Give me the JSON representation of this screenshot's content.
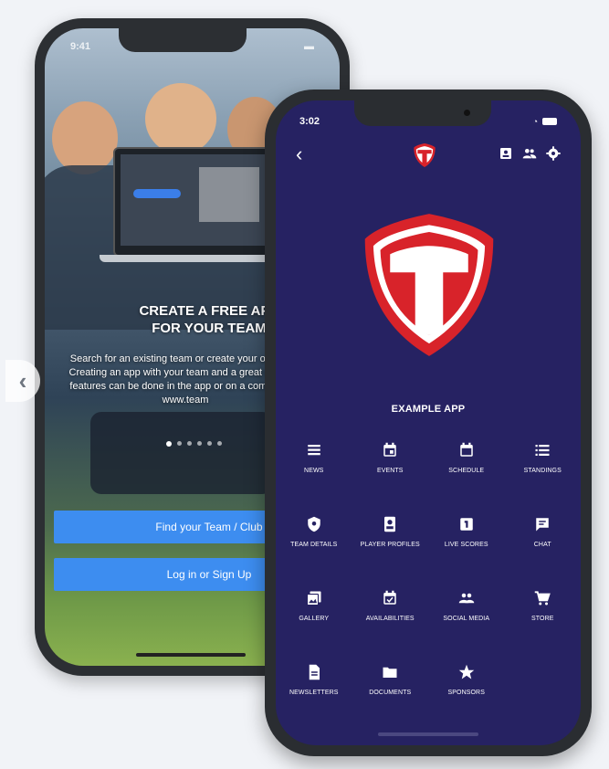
{
  "colors": {
    "front_bg": "#262262",
    "accent_red": "#d8232a",
    "button_blue": "#3d8df0"
  },
  "back_phone": {
    "status_time": "9:41",
    "hero_title_line1": "CREATE A FREE APP",
    "hero_title_line2": "FOR YOUR TEAM",
    "hero_body": "Search for an existing team or create your own app. Creating an app with your team and a great range of features can be done in the app or on a computer at www.team",
    "carousel_dots": 6,
    "find_button": "Find your Team / Club",
    "login_button": "Log in or Sign Up",
    "carousel_prev": "‹"
  },
  "front_phone": {
    "status_time": "3:02",
    "back_icon": "‹",
    "app_name": "EXAMPLE APP",
    "top_icons": [
      "contact-card-icon",
      "people-icon",
      "gear-icon"
    ],
    "tiles": [
      {
        "label": "NEWS",
        "icon": "news-icon"
      },
      {
        "label": "EVENTS",
        "icon": "calendar-event-icon"
      },
      {
        "label": "SCHEDULE",
        "icon": "calendar-icon"
      },
      {
        "label": "STANDINGS",
        "icon": "list-icon"
      },
      {
        "label": "TEAM DETAILS",
        "icon": "shield-icon"
      },
      {
        "label": "PLAYER PROFILES",
        "icon": "player-card-icon"
      },
      {
        "label": "LIVE SCORES",
        "icon": "score-icon"
      },
      {
        "label": "CHAT",
        "icon": "chat-icon"
      },
      {
        "label": "GALLERY",
        "icon": "gallery-icon"
      },
      {
        "label": "AVAILABILITIES",
        "icon": "calendar-check-icon"
      },
      {
        "label": "SOCIAL MEDIA",
        "icon": "group-icon"
      },
      {
        "label": "STORE",
        "icon": "cart-icon"
      },
      {
        "label": "NEWSLETTERS",
        "icon": "document-icon"
      },
      {
        "label": "DOCUMENTS",
        "icon": "folder-icon"
      },
      {
        "label": "SPONSORS",
        "icon": "star-icon"
      }
    ]
  }
}
